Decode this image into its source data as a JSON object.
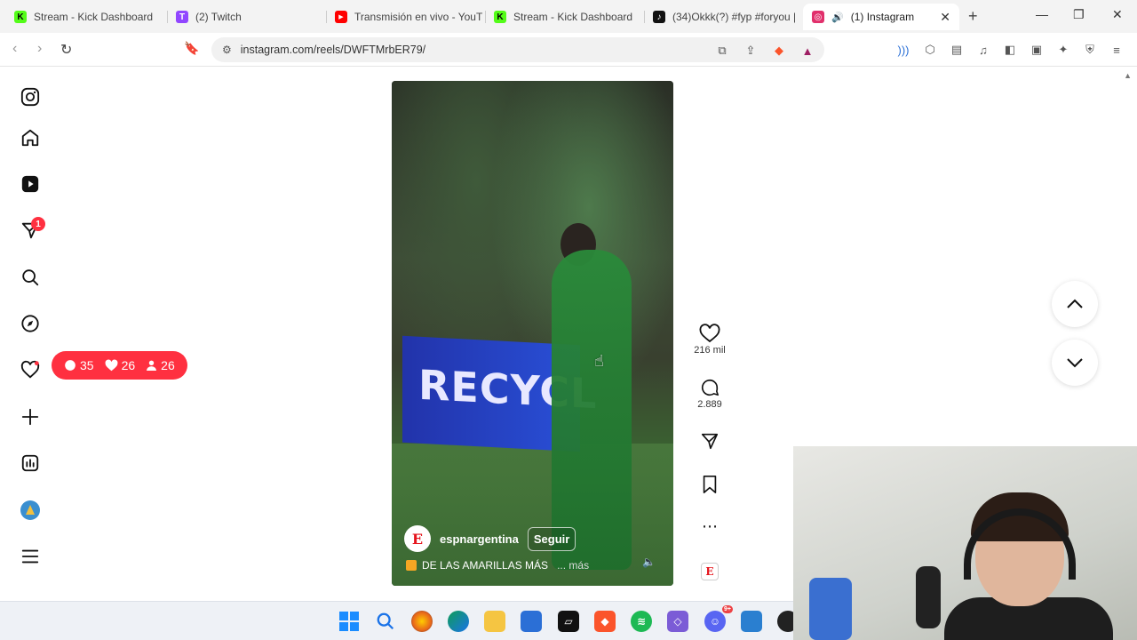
{
  "browser": {
    "tabs": [
      {
        "label": "Stream - Kick Dashboard",
        "fav": "K",
        "color": "#53fc18"
      },
      {
        "label": "(2) Twitch",
        "fav": "T",
        "color": "#9146ff"
      },
      {
        "label": "Transmisión en vivo - YouT",
        "fav": "▶",
        "color": "#ff0000"
      },
      {
        "label": "Stream - Kick Dashboard",
        "fav": "K",
        "color": "#53fc18"
      },
      {
        "label": "(34)Okkk(?) #fyp #foryou |",
        "fav": "♪",
        "color": "#111111"
      },
      {
        "label": "(1) Instagram",
        "fav": "◎",
        "color": "#e1306c"
      }
    ],
    "url": "instagram.com/reels/DWFTMrbER79/"
  },
  "sidebar": {
    "messages_badge": "1",
    "notifications": {
      "comments": "35",
      "likes": "26",
      "follows": "26"
    }
  },
  "reel": {
    "banner_text": "RECYCL",
    "account": "espnargentina",
    "avatar_letter": "E",
    "follow_label": "Seguir",
    "caption": "DE LAS AMARILLAS MÁS",
    "more_label": "... más",
    "likes": "216 mil",
    "comments": "2.889"
  },
  "taskbar": {
    "discord_badge": "9+"
  },
  "colors": {
    "accent_red": "#ff3040",
    "espn_red": "#e5141c",
    "kick_green": "#53fc18"
  }
}
